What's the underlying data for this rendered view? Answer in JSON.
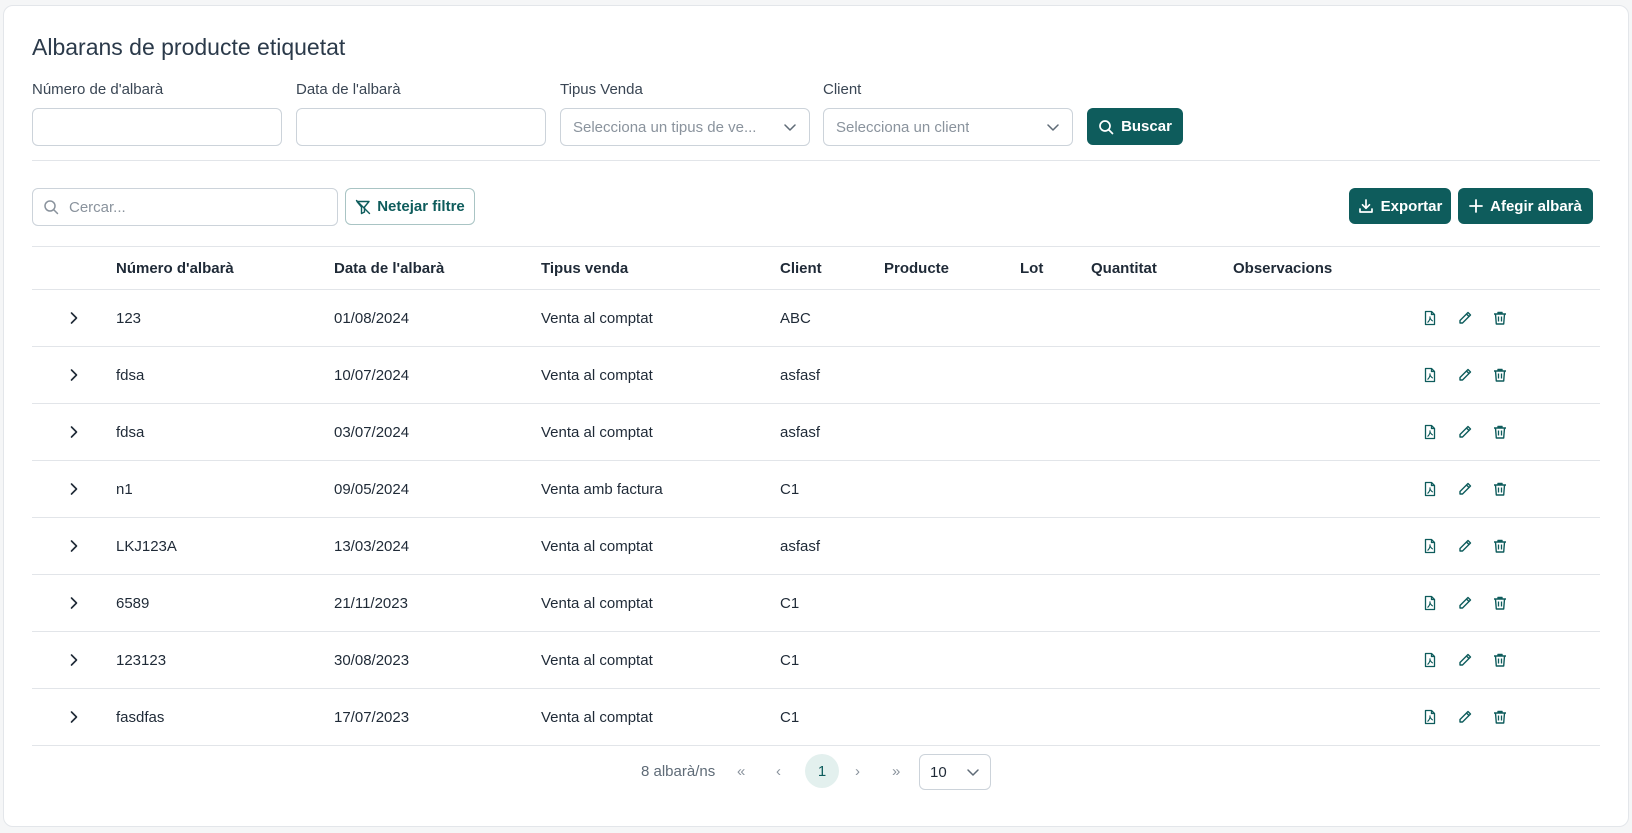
{
  "page": {
    "title": "Albarans de producte etiquetat"
  },
  "filters": {
    "numero_label": "Número de d'albarà",
    "data_label": "Data de l'albarà",
    "tipus_label": "Tipus Venda",
    "tipus_placeholder": "Selecciona un tipus de ve...",
    "client_label": "Client",
    "client_placeholder": "Selecciona un client",
    "search_button": "Buscar"
  },
  "toolbar": {
    "search_placeholder": "Cercar...",
    "clear_filter_button": "Netejar filtre",
    "export_button": "Exportar",
    "add_button": "Afegir albarà"
  },
  "table": {
    "headers": [
      "Número d'albarà",
      "Data de l'albarà",
      "Tipus venda",
      "Client",
      "Producte",
      "Lot",
      "Quantitat",
      "Observacions"
    ],
    "rows": [
      {
        "numero": "123",
        "data": "01/08/2024",
        "tipus": "Venta al comptat",
        "client": "ABC"
      },
      {
        "numero": "fdsa",
        "data": "10/07/2024",
        "tipus": "Venta al comptat",
        "client": "asfasf"
      },
      {
        "numero": "fdsa",
        "data": "03/07/2024",
        "tipus": "Venta al comptat",
        "client": "asfasf"
      },
      {
        "numero": "n1",
        "data": "09/05/2024",
        "tipus": "Venta amb factura",
        "client": "C1"
      },
      {
        "numero": "LKJ123A",
        "data": "13/03/2024",
        "tipus": "Venta al comptat",
        "client": "asfasf"
      },
      {
        "numero": "6589",
        "data": "21/11/2023",
        "tipus": "Venta al comptat",
        "client": "C1"
      },
      {
        "numero": "123123",
        "data": "30/08/2023",
        "tipus": "Venta al comptat",
        "client": "C1"
      },
      {
        "numero": "fasdfas",
        "data": "17/07/2023",
        "tipus": "Venta al comptat",
        "client": "C1"
      }
    ]
  },
  "pagination": {
    "count_label": "8 albarà/ns",
    "first": "«",
    "prev": "‹",
    "current_page": "1",
    "next": "›",
    "last": "»",
    "page_size": "10"
  },
  "colors": {
    "primary": "#0e5c5c",
    "accent_light": "#e3f0ee"
  }
}
